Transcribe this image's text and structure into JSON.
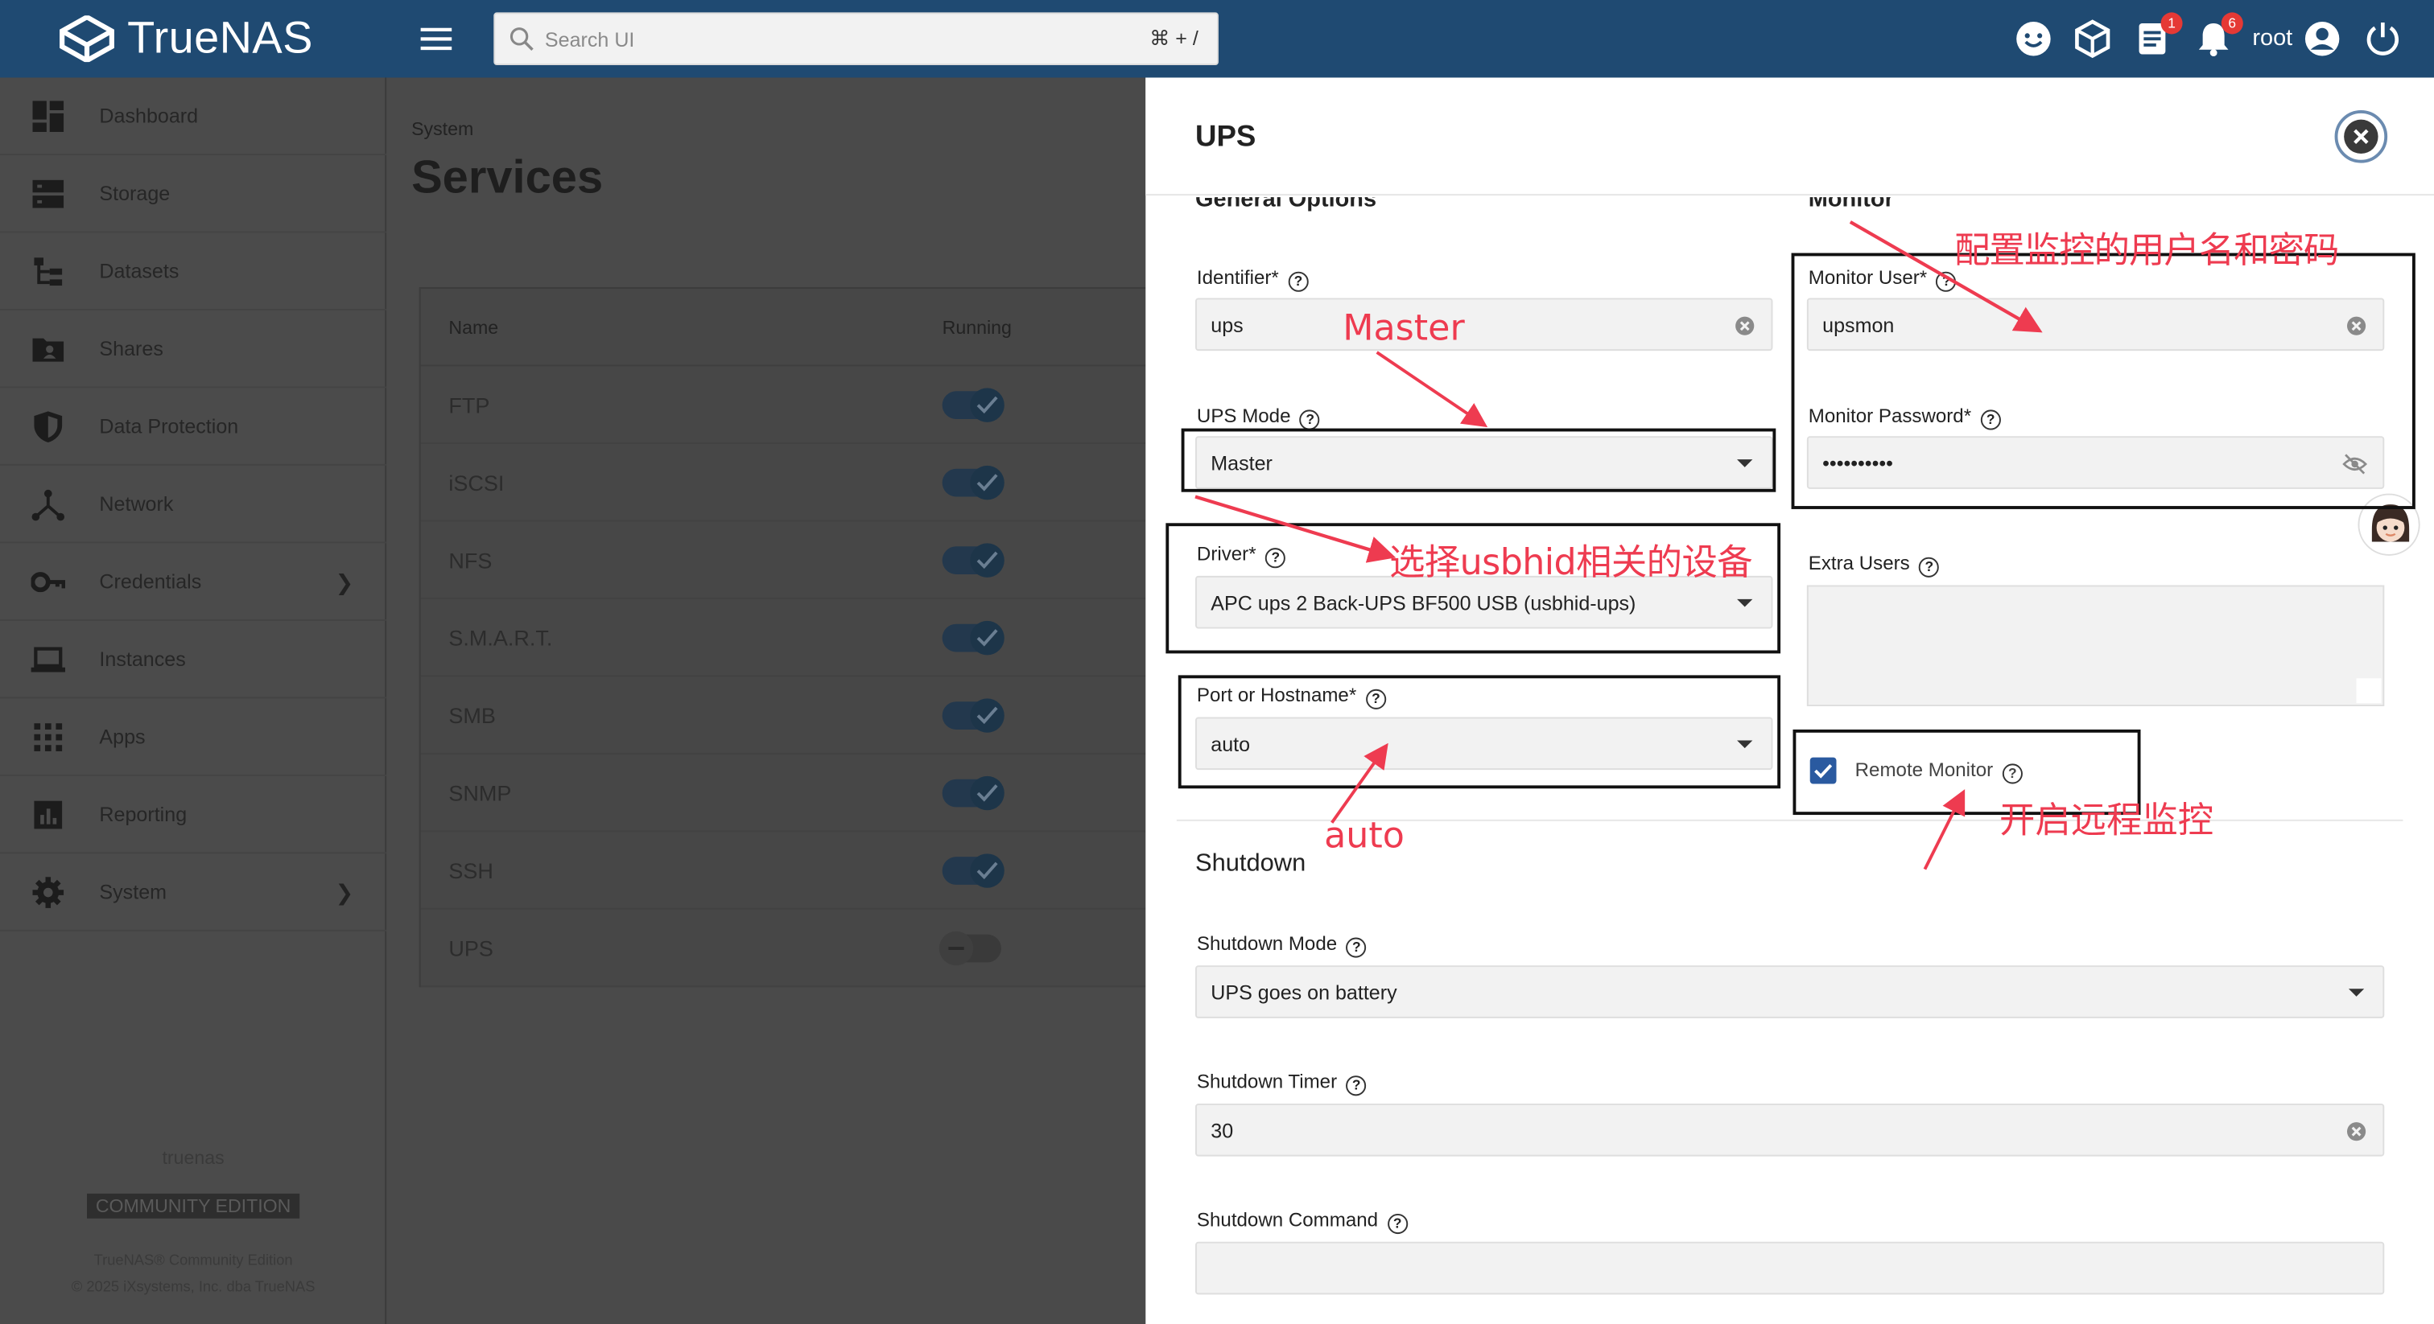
{
  "topbar": {
    "logo": "TrueNAS",
    "search_placeholder": "Search UI",
    "search_shortcut": "⌘ + /",
    "jobs_badge": "1",
    "alerts_badge": "6",
    "username": "root"
  },
  "sidebar": {
    "items": [
      {
        "label": "Dashboard",
        "icon": "dashboard-icon",
        "has_children": false
      },
      {
        "label": "Storage",
        "icon": "storage-icon",
        "has_children": false
      },
      {
        "label": "Datasets",
        "icon": "datasets-icon",
        "has_children": false
      },
      {
        "label": "Shares",
        "icon": "shares-icon",
        "has_children": false
      },
      {
        "label": "Data Protection",
        "icon": "shield-icon",
        "has_children": false
      },
      {
        "label": "Network",
        "icon": "network-icon",
        "has_children": false
      },
      {
        "label": "Credentials",
        "icon": "key-icon",
        "has_children": true
      },
      {
        "label": "Instances",
        "icon": "laptop-icon",
        "has_children": false
      },
      {
        "label": "Apps",
        "icon": "apps-grid-icon",
        "has_children": false
      },
      {
        "label": "Reporting",
        "icon": "chart-icon",
        "has_children": false
      },
      {
        "label": "System",
        "icon": "gear-icon",
        "has_children": true
      }
    ],
    "hostname": "truenas",
    "edition": "COMMUNITY EDITION",
    "footer_line1": "TrueNAS® Community Edition",
    "footer_line2": "© 2025 iXsystems, Inc. dba TrueNAS"
  },
  "main": {
    "breadcrumb": "System",
    "title": "Services",
    "table": {
      "columns": [
        "Name",
        "Running"
      ],
      "rows": [
        {
          "name": "FTP",
          "running": true
        },
        {
          "name": "iSCSI",
          "running": true
        },
        {
          "name": "NFS",
          "running": true
        },
        {
          "name": "S.M.A.R.T.",
          "running": true
        },
        {
          "name": "SMB",
          "running": true
        },
        {
          "name": "SNMP",
          "running": true
        },
        {
          "name": "SSH",
          "running": true
        },
        {
          "name": "UPS",
          "running": false
        }
      ]
    }
  },
  "panel": {
    "title": "UPS",
    "general_section": "General Options",
    "monitor_section": "Monitor",
    "identifier_label": "Identifier",
    "identifier_value": "ups",
    "ups_mode_label": "UPS Mode",
    "ups_mode_value": "Master",
    "driver_label": "Driver",
    "driver_value": "APC ups 2 Back-UPS BF500 USB (usbhid-ups)",
    "port_label": "Port or Hostname",
    "port_value": "auto",
    "monitor_user_label": "Monitor User",
    "monitor_user_value": "upsmon",
    "monitor_password_label": "Monitor Password",
    "monitor_password_value": "••••••••••",
    "extra_users_label": "Extra Users",
    "remote_monitor_label": "Remote Monitor",
    "remote_monitor_checked": true,
    "shutdown_section": "Shutdown",
    "shutdown_mode_label": "Shutdown Mode",
    "shutdown_mode_value": "UPS goes on battery",
    "shutdown_timer_label": "Shutdown Timer",
    "shutdown_timer_value": "30",
    "shutdown_command_label": "Shutdown Command",
    "required_mark": "*"
  },
  "annotations": {
    "master": "Master",
    "driver_note": "选择usbhid相关的设备",
    "auto": "auto",
    "monitor_note": "配置监控的用户名和密码",
    "remote_note": "开启远程监控",
    "color": "#ee3b50"
  }
}
